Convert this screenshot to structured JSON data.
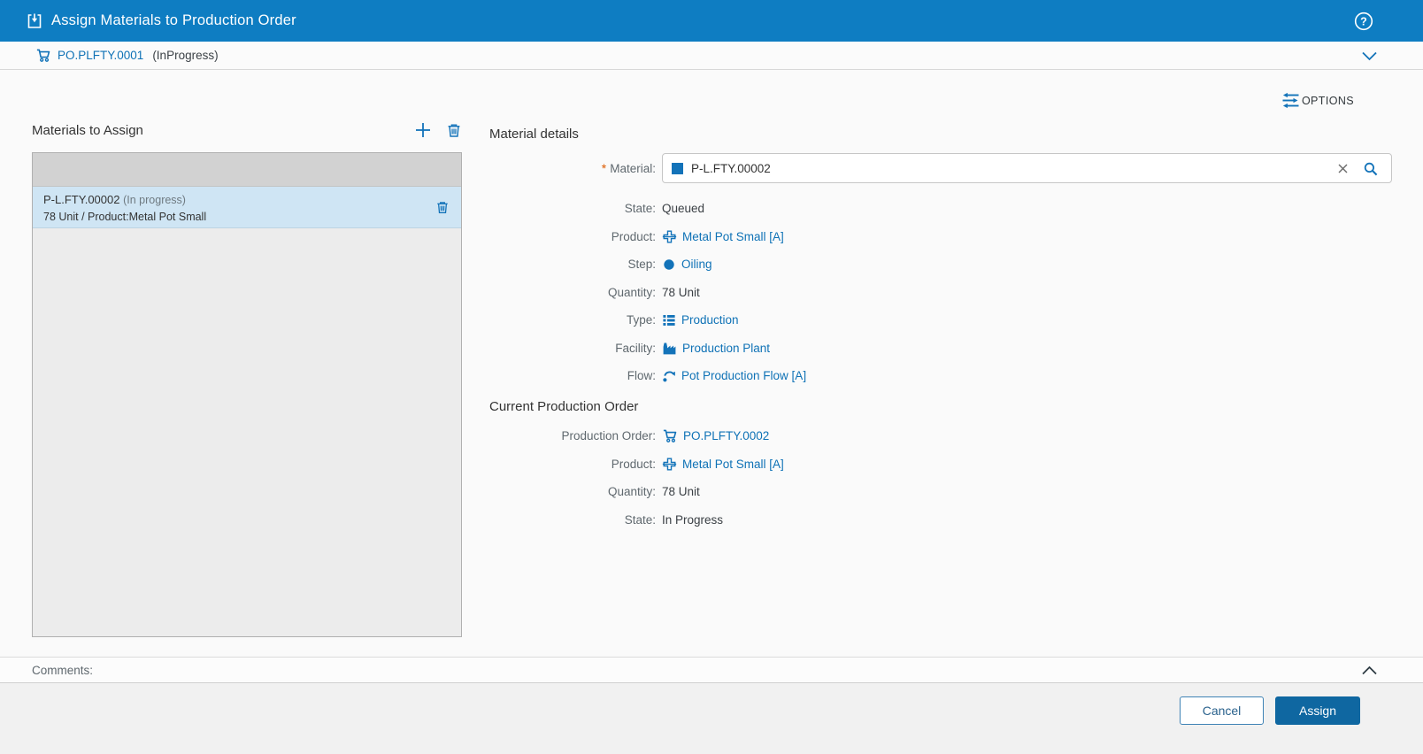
{
  "header": {
    "title": "Assign Materials to Production Order"
  },
  "context_bar": {
    "order_id": "PO.PLFTY.0001",
    "state": "(InProgress)"
  },
  "options": {
    "label": "OPTIONS"
  },
  "left_panel": {
    "title": "Materials to Assign",
    "item": {
      "name": "P-L.FTY.00002",
      "state": "(In progress)",
      "detail": "78 Unit / Product:Metal Pot Small"
    }
  },
  "details": {
    "title": "Material details",
    "required_marker": "*",
    "material_label": "Material:",
    "material_value": "P-L.FTY.00002",
    "fields": [
      {
        "label": "State:",
        "value": "Queued"
      },
      {
        "label": "Product:",
        "value": "Metal Pot Small [A]"
      },
      {
        "label": "Step:",
        "value": "Oiling"
      },
      {
        "label": "Quantity:",
        "value": "78 Unit"
      },
      {
        "label": "Type:",
        "value": "Production"
      },
      {
        "label": "Facility:",
        "value": "Production Plant"
      },
      {
        "label": "Flow:",
        "value": "Pot Production Flow [A]"
      }
    ]
  },
  "current_order": {
    "title": "Current Production Order",
    "fields": [
      {
        "label": "Production Order:",
        "value": "PO.PLFTY.0002"
      },
      {
        "label": "Product:",
        "value": "Metal Pot Small [A]"
      },
      {
        "label": "Quantity:",
        "value": "78 Unit"
      },
      {
        "label": "State:",
        "value": "In Progress"
      }
    ]
  },
  "comments": {
    "label": "Comments:"
  },
  "footer": {
    "cancel_label": "Cancel",
    "assign_label": "Assign"
  },
  "colors": {
    "header_bg": "#0e7dc2",
    "accent_blue": "#1373b9",
    "link_blue": "#0f72b6",
    "assign_button_bg": "#0f67a1",
    "selected_row_bg": "#cfe5f4",
    "required_marker": "#dc5a00"
  }
}
